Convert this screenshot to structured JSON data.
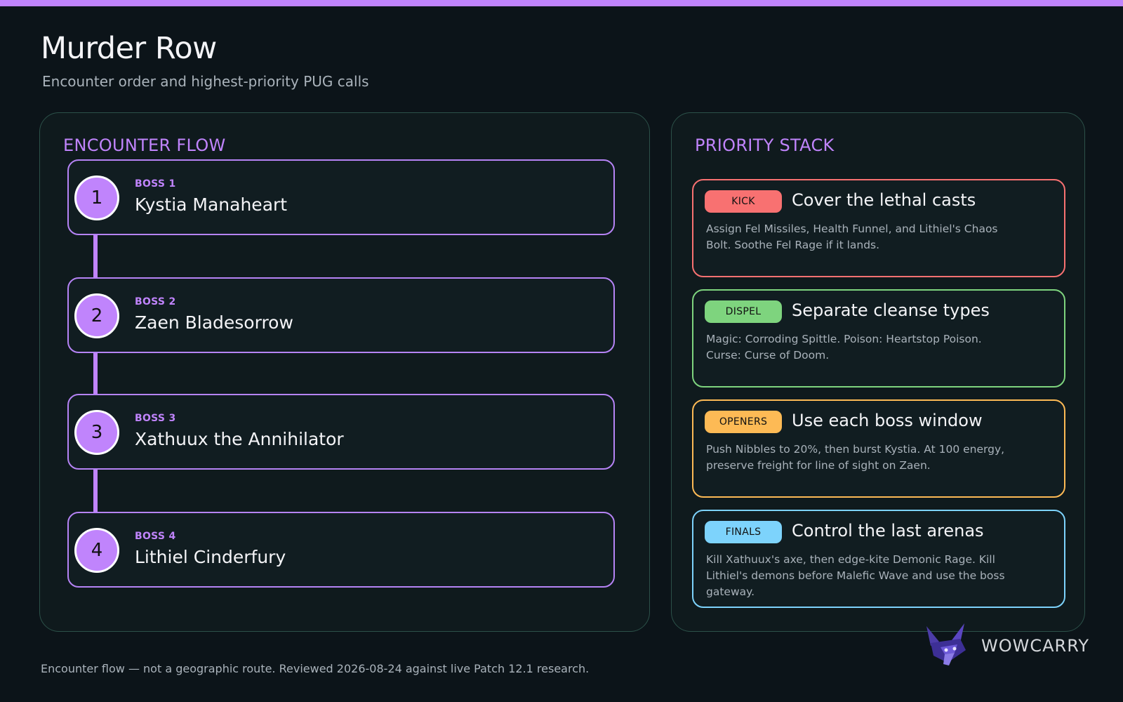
{
  "colors": {
    "accent": "#c084fc",
    "boss_circle": "#c084fc",
    "kick": "#f87171",
    "dispel": "#7ed47e",
    "openers": "#fdba55",
    "finals": "#7dd3fc"
  },
  "header": {
    "title": "Murder Row",
    "subtitle": "Encounter order and highest-priority PUG calls"
  },
  "encounter_flow": {
    "heading": "ENCOUNTER FLOW",
    "bosses": [
      {
        "number": "1",
        "label": "BOSS 1",
        "name": "Kystia Manaheart"
      },
      {
        "number": "2",
        "label": "BOSS 2",
        "name": "Zaen Bladesorrow"
      },
      {
        "number": "3",
        "label": "BOSS 3",
        "name": "Xathuux the Annihilator"
      },
      {
        "number": "4",
        "label": "BOSS 4",
        "name": "Lithiel Cinderfury"
      }
    ]
  },
  "priority_stack": {
    "heading": "PRIORITY STACK",
    "items": [
      {
        "tag": "KICK",
        "title": "Cover the lethal casts",
        "body": "Assign Fel Missiles, Health Funnel, and Lithiel's Chaos Bolt. Soothe Fel Rage if it lands."
      },
      {
        "tag": "DISPEL",
        "title": "Separate cleanse types",
        "body": "Magic: Corroding Spittle. Poison: Heartstop Poison. Curse: Curse of Doom."
      },
      {
        "tag": "OPENERS",
        "title": "Use each boss window",
        "body": "Push Nibbles to 20%, then burst Kystia. At 100 energy, preserve freight for line of sight on Zaen."
      },
      {
        "tag": "FINALS",
        "title": "Control the last arenas",
        "body": "Kill Xathuux's axe, then edge-kite Demonic Rage. Kill Lithiel's demons before Malefic Wave and use the boss gateway."
      }
    ]
  },
  "footer": {
    "note": "Encounter flow — not a geographic route. Reviewed 2026-08-24 against live Patch 12.1 research.",
    "brand_name": "WOWCARRY",
    "brand_logo_icon": "fox-logo-icon"
  }
}
